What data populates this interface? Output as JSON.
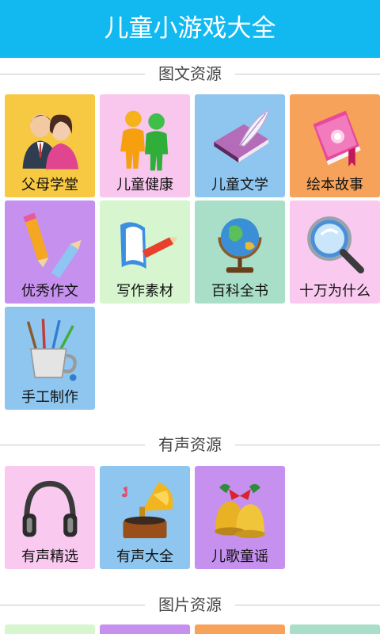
{
  "app": {
    "title": "儿童小游戏大全",
    "accent": "#12b9f0"
  },
  "sections": [
    {
      "title": "图文资源",
      "items": [
        {
          "label": "父母学堂",
          "icon": "parents-icon",
          "color": "#f7c842"
        },
        {
          "label": "儿童健康",
          "icon": "children-figures-icon",
          "color": "#f9c6ee"
        },
        {
          "label": "儿童文学",
          "icon": "book-quill-icon",
          "color": "#8fc6ef"
        },
        {
          "label": "绘本故事",
          "icon": "pink-diary-icon",
          "color": "#f6a25a"
        },
        {
          "label": "优秀作文",
          "icon": "pencils-icon",
          "color": "#c690ee"
        },
        {
          "label": "写作素材",
          "icon": "scroll-pencil-icon",
          "color": "#d7f5cf"
        },
        {
          "label": "百科全书",
          "icon": "globe-icon",
          "color": "#a9dfc9"
        },
        {
          "label": "十万为什么",
          "icon": "magnifier-icon",
          "color": "#f9c9f0"
        },
        {
          "label": "手工制作",
          "icon": "brush-cup-icon",
          "color": "#8fc6ef"
        }
      ]
    },
    {
      "title": "有声资源",
      "items": [
        {
          "label": "有声精选",
          "icon": "headphones-icon",
          "color": "#f9c9f0"
        },
        {
          "label": "有声大全",
          "icon": "gramophone-icon",
          "color": "#8fc6ef"
        },
        {
          "label": "儿歌童谣",
          "icon": "bells-icon",
          "color": "#c690ee"
        }
      ]
    },
    {
      "title": "图片资源",
      "items": [
        {
          "color": "#d7f5cf"
        },
        {
          "color": "#c690ee"
        },
        {
          "color": "#f6a25a"
        },
        {
          "color": "#a9dfc9"
        }
      ]
    }
  ]
}
